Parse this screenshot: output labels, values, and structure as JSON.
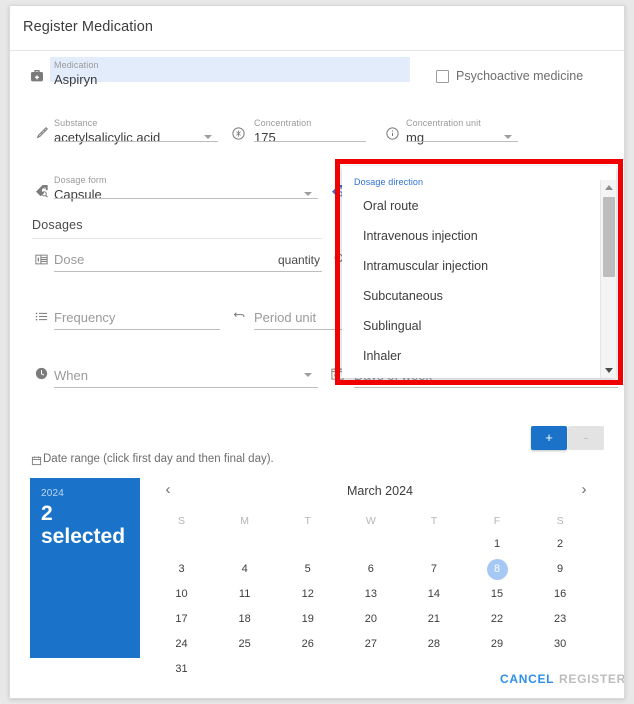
{
  "dialog": {
    "title": "Register Medication"
  },
  "fields": {
    "medication": {
      "label": "Medication",
      "value": "Aspiryn",
      "icon": "medical-bag-icon"
    },
    "psychoactive": {
      "label": "Psychoactive medicine",
      "checked": false
    },
    "substance": {
      "label": "Substance",
      "value": "acetylsalicylic acid",
      "icon": "syringe-icon"
    },
    "concentration": {
      "label": "Concentration",
      "value": "175",
      "icon": "head-icon"
    },
    "concentration_unit": {
      "label": "Concentration unit",
      "value": "mg",
      "icon": "info-icon"
    },
    "dosage_form": {
      "label": "Dosage form",
      "value": "Capsule",
      "icon": "tag-search-icon"
    },
    "dosage_direction": {
      "label": "Dosage direction",
      "value": "",
      "icon": "tag-search-blue-icon"
    },
    "dose": {
      "label": "",
      "placeholder": "Dose",
      "suffix": "quantity",
      "icon": "table-icon"
    },
    "frequency": {
      "label": "",
      "placeholder": "Frequency",
      "icon": "list-icon"
    },
    "period_unit": {
      "label": "",
      "placeholder": "Period unit",
      "icon": "repeat-icon"
    },
    "when": {
      "label": "",
      "placeholder": "When",
      "icon": "clock-icon"
    },
    "days_of_week": {
      "label": "",
      "placeholder": "Days of week",
      "icon": "calendar-icon"
    }
  },
  "sections": {
    "dosages": "Dosages"
  },
  "dropdown": {
    "label": "Dosage direction",
    "options": [
      "Oral route",
      "Intravenous injection",
      "Intramuscular injection",
      "Subcutaneous",
      "Sublingual",
      "Inhaler"
    ],
    "scroll_up": "scroll-up-arrow",
    "scroll_down": "scroll-down-arrow"
  },
  "dosage_controls": {
    "add": "+",
    "remove": "-"
  },
  "date_range": {
    "label": "Date range (click first day and then final day).",
    "icon": "calendar-range-icon",
    "selection": {
      "year": "2024",
      "count": "2",
      "word": "selected"
    },
    "calendar": {
      "month_title": "March 2024",
      "prev": "‹",
      "next": "›",
      "dow": [
        "S",
        "M",
        "T",
        "W",
        "T",
        "F",
        "S"
      ],
      "weeks": [
        [
          "",
          "",
          "",
          "",
          "",
          "1",
          "2"
        ],
        [
          "3",
          "4",
          "5",
          "6",
          "7",
          "8",
          "9"
        ],
        [
          "10",
          "11",
          "12",
          "13",
          "14",
          "15",
          "16"
        ],
        [
          "17",
          "18",
          "19",
          "20",
          "21",
          "22",
          "23"
        ],
        [
          "24",
          "25",
          "26",
          "27",
          "28",
          "29",
          "30"
        ],
        [
          "31",
          "",
          "",
          "",
          "",
          "",
          ""
        ]
      ],
      "today": "8"
    }
  },
  "footer": {
    "cancel": "CANCEL",
    "register": "REGISTER"
  },
  "colors": {
    "accent": "#1a73c8",
    "link": "#2f8fea",
    "highlight_field": "#e3ecfb",
    "today_circle": "#a5c8f5",
    "frame": "#f00000"
  }
}
